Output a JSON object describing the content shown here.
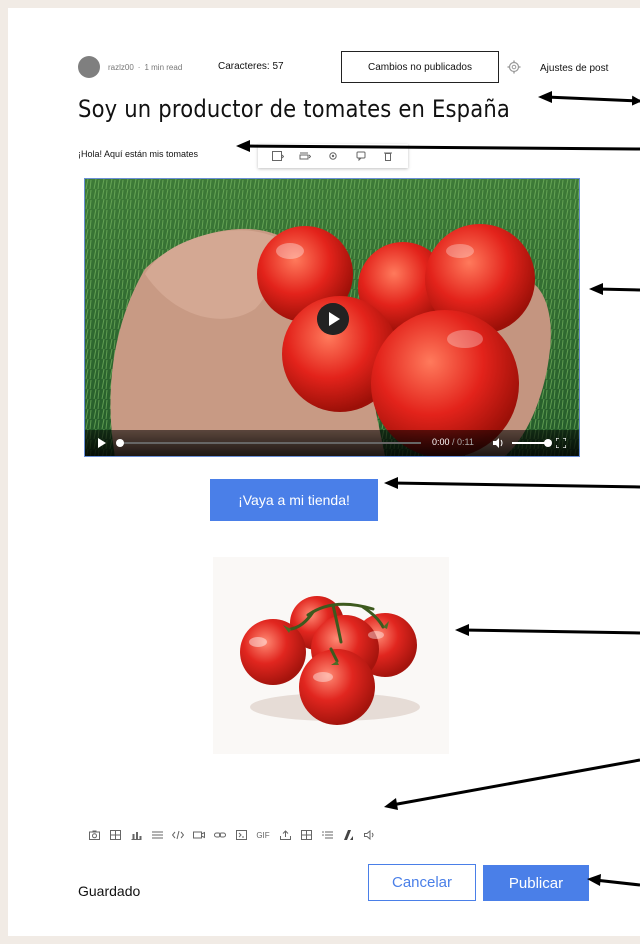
{
  "header": {
    "author": "razlz00",
    "read_time": "1 min read",
    "char_count": "Caracteres: 57",
    "unpublished": "Cambios no publicados",
    "settings": "Ajustes de post"
  },
  "post": {
    "title": "Soy un productor de tomates en España",
    "intro": "¡Hola! Aquí están mis tomates",
    "shop_button": "¡Vaya a mi tienda!"
  },
  "video": {
    "current_time": "0:00",
    "duration": "/ 0:11",
    "progress": 0,
    "volume": 1
  },
  "toolbar": {
    "items": [
      "camera-icon",
      "gallery-icon",
      "chart-icon",
      "divider-icon",
      "code-icon",
      "video-icon",
      "link-icon",
      "embed-icon",
      "gif-icon",
      "upload-icon",
      "table-icon",
      "list-icon",
      "format-icon",
      "audio-icon"
    ],
    "gif_label": "GIF"
  },
  "footer": {
    "status": "Guardado",
    "cancel": "Cancelar",
    "publish": "Publicar"
  },
  "colors": {
    "accent": "#4a7fe8",
    "background": "#f1ebe5"
  }
}
